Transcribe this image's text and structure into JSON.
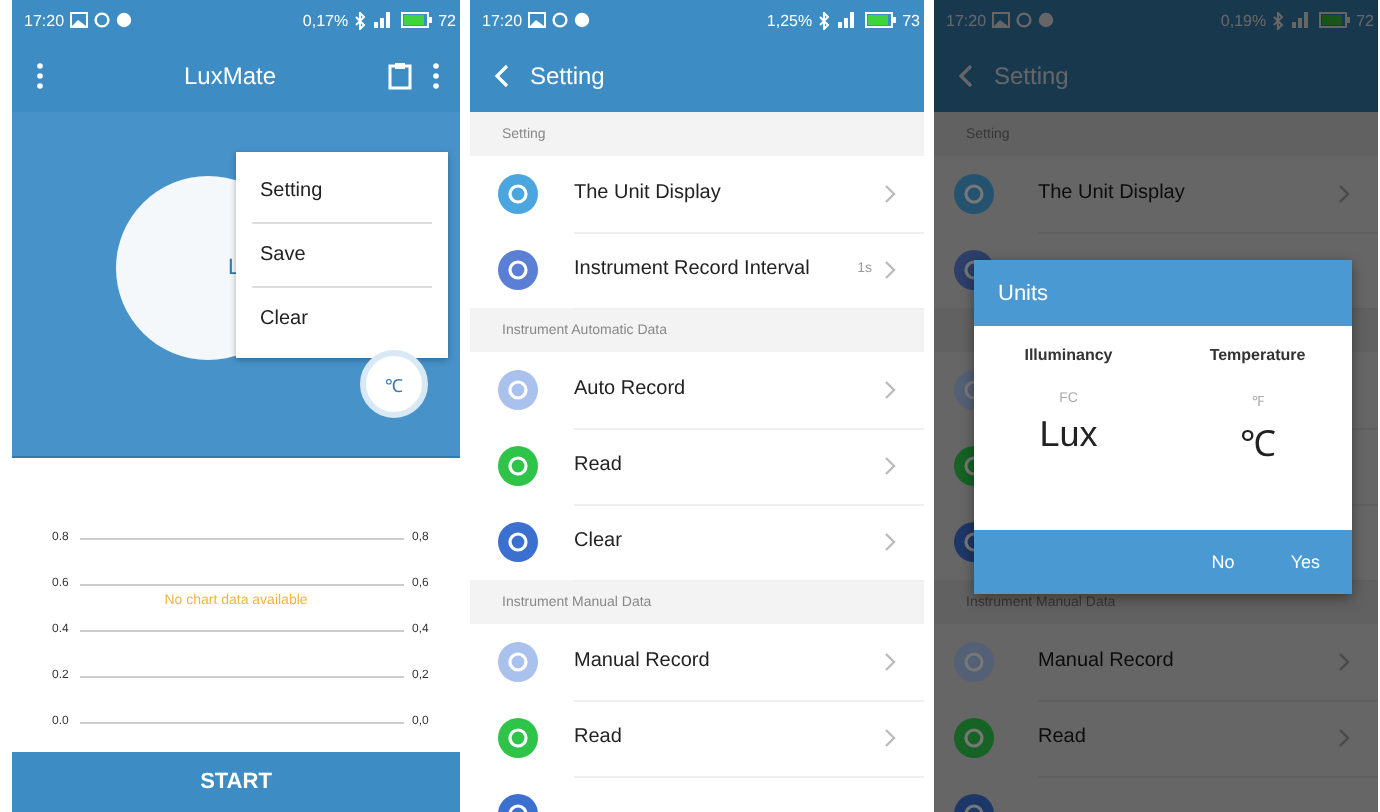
{
  "panels": [
    {
      "kind": "home",
      "status": {
        "time": "17:20",
        "rate": "0,17%",
        "battery": "72"
      },
      "title": "LuxMate",
      "gauge_text": "L",
      "menu": [
        {
          "label": "Setting"
        },
        {
          "label": "Save"
        },
        {
          "label": "Clear"
        }
      ],
      "unit_button": "℃",
      "chart": {
        "left_ticks": [
          "0.8",
          "0.6",
          "0.4",
          "0.2",
          "0.0"
        ],
        "right_ticks": [
          "0,8",
          "0,6",
          "0,4",
          "0,2",
          "0,0"
        ],
        "empty_message": "No chart data available"
      },
      "start_button": "START"
    },
    {
      "kind": "settings",
      "status": {
        "time": "17:20",
        "rate": "1,25%",
        "battery": "73"
      },
      "title": "Setting",
      "sections": [
        {
          "header": "Setting",
          "items": [
            {
              "label": "The Unit Display",
              "color": "#4ba6df"
            },
            {
              "label": "Instrument Record Interval",
              "value": "1s",
              "color": "#5a7fd4"
            }
          ]
        },
        {
          "header": "Instrument Automatic Data",
          "items": [
            {
              "label": "Auto Record",
              "color": "#a9c1ec"
            },
            {
              "label": "Read",
              "color": "#2ec44a"
            },
            {
              "label": "Clear",
              "color": "#3b6fd0"
            }
          ]
        },
        {
          "header": "Instrument Manual Data",
          "items": [
            {
              "label": "Manual Record",
              "color": "#a9c1ec"
            },
            {
              "label": "Read",
              "color": "#2ec44a"
            },
            {
              "color": "#3b6fd0"
            }
          ]
        }
      ]
    },
    {
      "kind": "settings_dialog",
      "status": {
        "time": "17:20",
        "rate": "0,19%",
        "battery": "72"
      },
      "title": "Setting",
      "sections": [
        {
          "header": "Setting",
          "items": [
            {
              "label": "The Unit Display",
              "color": "#25536f"
            },
            {
              "color": "#2d3f6a"
            }
          ]
        },
        {
          "items": [
            {
              "color": "#546076"
            },
            {
              "color": "#176225"
            },
            {
              "color": "#1d3768"
            }
          ]
        },
        {
          "header": "Instrument Manual Data",
          "items": [
            {
              "label": "Manual Record",
              "color": "#546076"
            },
            {
              "label": "Read",
              "color": "#176225"
            },
            {
              "color": "#1d3768"
            }
          ]
        }
      ],
      "dialog": {
        "title": "Units",
        "columns": [
          {
            "heading": "Illuminancy",
            "option": "FC",
            "unit": "Lux"
          },
          {
            "heading": "Temperature",
            "option": "℉",
            "unit": "℃"
          }
        ],
        "buttons": [
          "No",
          "Yes"
        ]
      }
    }
  ]
}
